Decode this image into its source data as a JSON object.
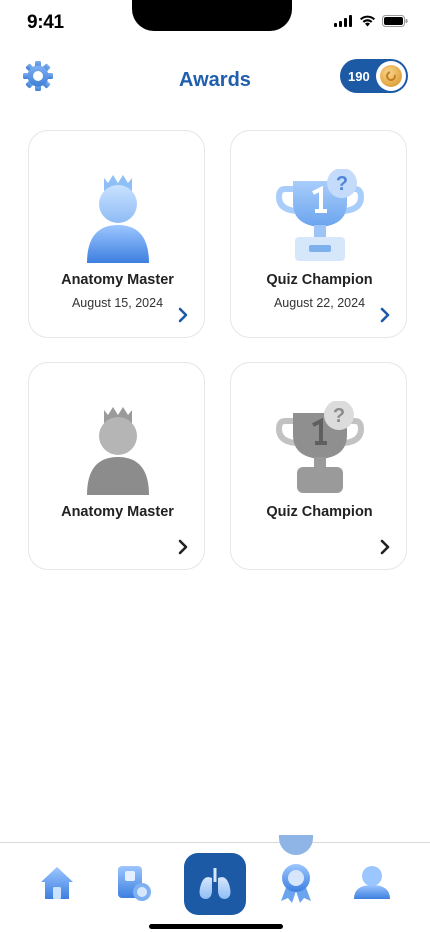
{
  "status_bar": {
    "time": "9:41"
  },
  "header": {
    "title": "Awards",
    "coins": "190"
  },
  "awards": [
    {
      "name": "Anatomy Master",
      "date": "August 15, 2024",
      "earned": true,
      "icon": "anatomy-master-badge-icon"
    },
    {
      "name": "Quiz Champion",
      "date": "August 22, 2024",
      "earned": true,
      "icon": "quiz-champion-trophy-icon"
    },
    {
      "name": "Anatomy Master",
      "date": "",
      "earned": false,
      "icon": "anatomy-master-badge-locked-icon"
    },
    {
      "name": "Quiz Champion",
      "date": "",
      "earned": false,
      "icon": "quiz-champion-trophy-locked-icon"
    }
  ],
  "nav": {
    "items": [
      "home-icon",
      "study-icon",
      "lungs-icon",
      "award-ribbon-icon",
      "profile-icon"
    ],
    "active": "award-ribbon-icon"
  },
  "colors": {
    "brand": "#1d5aa6",
    "title": "#1f5fae",
    "earned_light": "#8fb4e6",
    "locked": "#8c8c8c"
  }
}
